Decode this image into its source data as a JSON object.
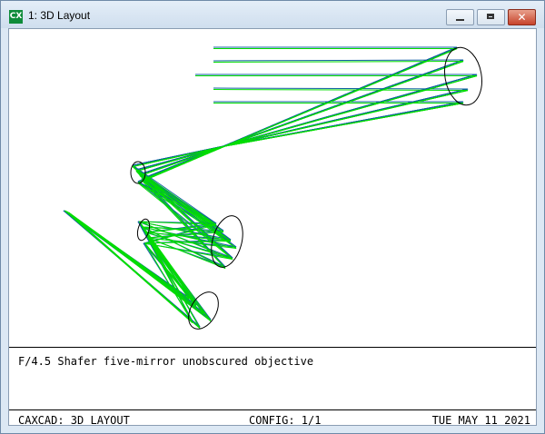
{
  "window": {
    "icon_text": "CX",
    "title": "1: 3D Layout",
    "close_glyph": "✕"
  },
  "caption": "F/4.5 Shafer five-mirror unobscured objective",
  "status": {
    "left": "CAXCAD: 3D LAYOUT",
    "center": "CONFIG: 1/1",
    "right": "TUE MAY 11 2021"
  },
  "colors": {
    "ray_green": "#00dd00",
    "ray_blue": "#1060a0",
    "mirror": "#000000"
  }
}
